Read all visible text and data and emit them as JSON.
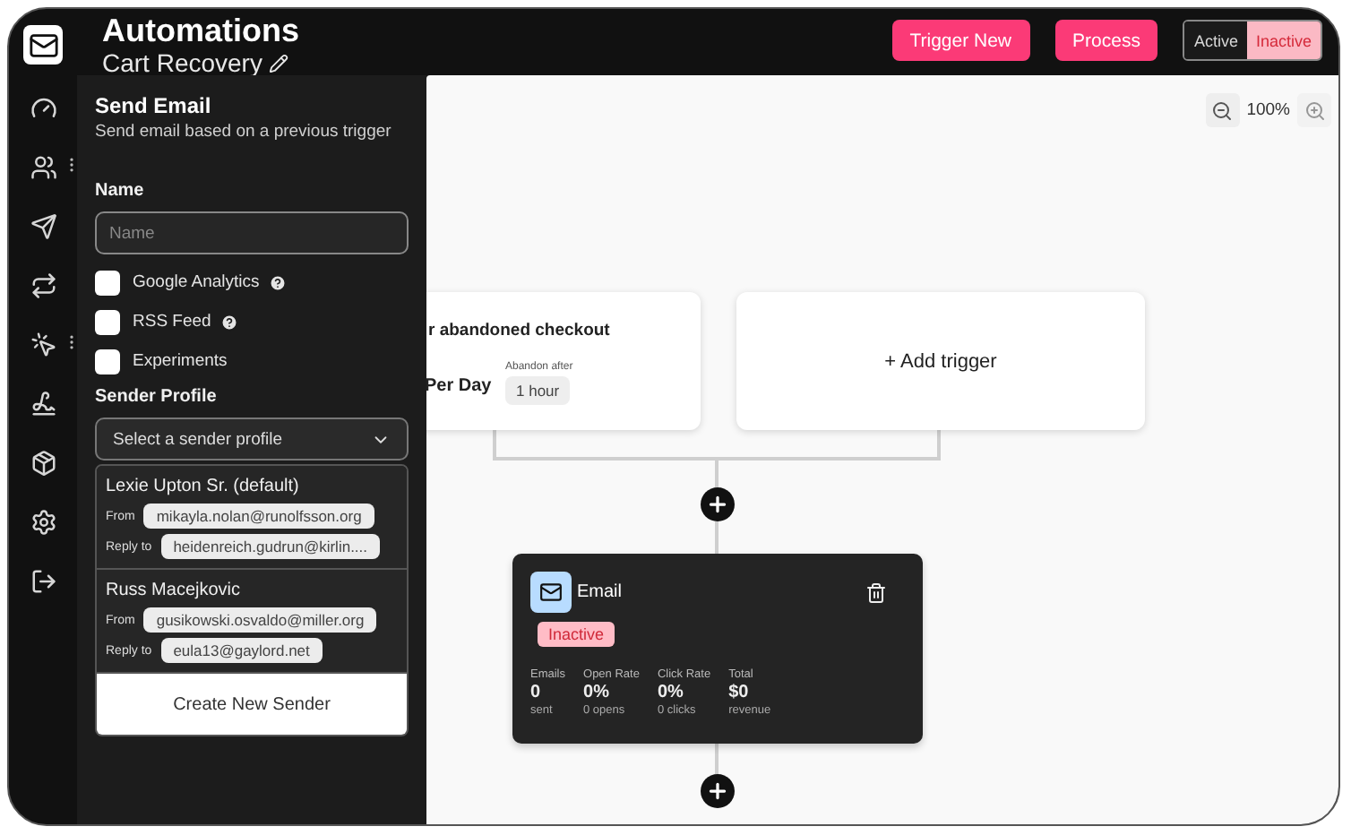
{
  "nav": [
    {
      "kind": "gauge",
      "menu": false
    },
    {
      "kind": "users",
      "menu": true
    },
    {
      "kind": "send",
      "menu": false
    },
    {
      "kind": "repeat",
      "menu": false
    },
    {
      "kind": "click",
      "menu": true
    },
    {
      "kind": "signature",
      "menu": false
    },
    {
      "kind": "package",
      "menu": false
    },
    {
      "kind": "settings",
      "menu": false
    },
    {
      "kind": "logout",
      "menu": false
    }
  ],
  "header": {
    "title": "Automations",
    "subtitle": "Cart Recovery",
    "buttons": [
      "Trigger New",
      "Process"
    ],
    "toggle": [
      {
        "label": "Active",
        "selected": false
      },
      {
        "label": "Inactive",
        "selected": true
      }
    ]
  },
  "panel": {
    "title": "Send Email",
    "description": "Send email based on a previous trigger",
    "name_label": "Name",
    "name_placeholder": "Name",
    "options": [
      {
        "label": "Google Analytics",
        "checked": false,
        "help": true
      },
      {
        "label": "RSS Feed",
        "checked": false,
        "help": true
      },
      {
        "label": "Experiments",
        "checked": false,
        "help": false
      }
    ],
    "sender_label": "Sender Profile",
    "sender_placeholder": "Select a sender profile",
    "senders": [
      {
        "name": "Lexie Upton Sr. (default)",
        "from_label": "From",
        "from": "mikayla.nolan@runolfsson.org",
        "reply_label": "Reply to",
        "reply_to": "heidenreich.gudrun@kirlin...."
      },
      {
        "name": "Russ Macejkovic",
        "from_label": "From",
        "from": "gusikowski.osvaldo@miller.org",
        "reply_label": "Reply to",
        "reply_to": "eula13@gaylord.net"
      }
    ],
    "create_button": "Create New Sender"
  },
  "canvas": {
    "zoom": "100%",
    "trigger": {
      "title": "r abandoned checkout",
      "value": "Per Day",
      "field_label": "Abandon after",
      "field_value": "1 hour"
    },
    "add_trigger": "+ Add trigger",
    "node": {
      "title": "Email",
      "status": {
        "label": "Inactive",
        "active": false
      },
      "stats": [
        {
          "label": "Emails",
          "value": "0",
          "sub": "sent"
        },
        {
          "label": "Open Rate",
          "value": "0%",
          "sub": "0 opens"
        },
        {
          "label": "Click Rate",
          "value": "0%",
          "sub": "0 clicks"
        },
        {
          "label": "Total",
          "value": "$0",
          "sub": "revenue"
        }
      ]
    }
  }
}
